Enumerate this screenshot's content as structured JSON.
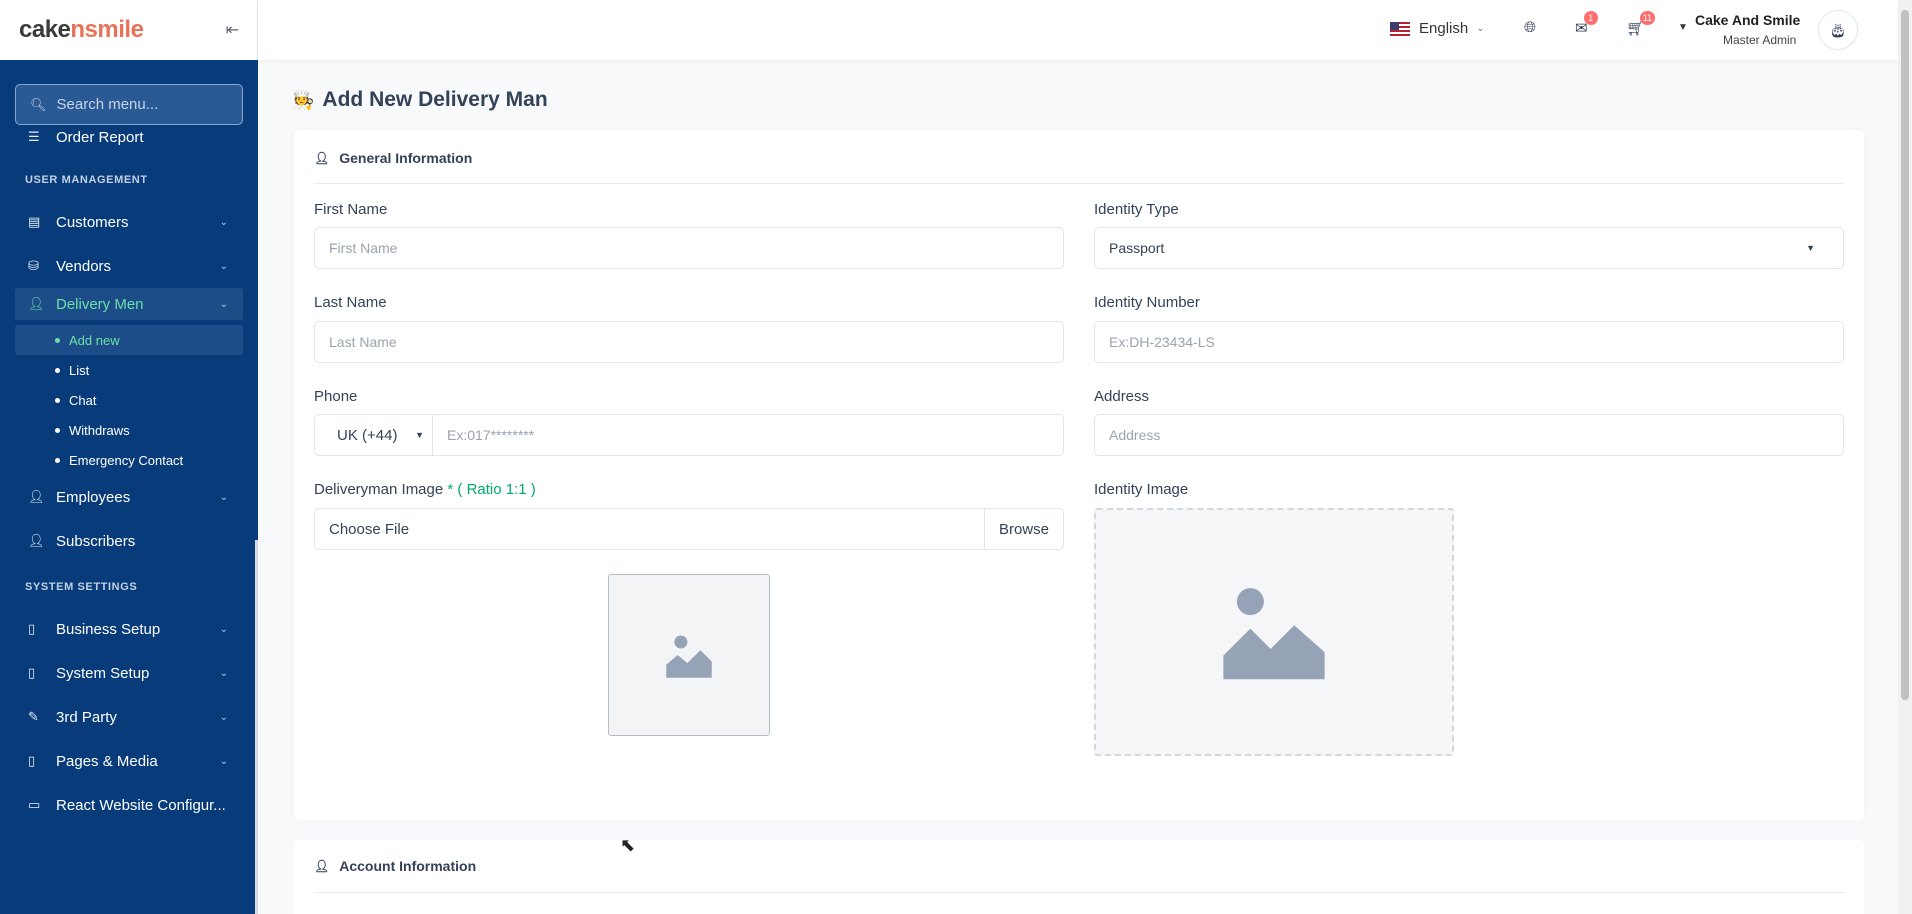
{
  "brand": {
    "part1": "cake",
    "part2": "nsmile"
  },
  "sidebar": {
    "search_placeholder": "Search menu...",
    "partial_item": "Order Report",
    "section_user": "USER MANAGEMENT",
    "customers": "Customers",
    "vendors": "Vendors",
    "delivery_men": "Delivery Men",
    "sub": [
      "Add new",
      "List",
      "Chat",
      "Withdraws",
      "Emergency Contact"
    ],
    "employees": "Employees",
    "subscribers": "Subscribers",
    "section_system": "SYSTEM SETTINGS",
    "business_setup": "Business Setup",
    "system_setup": "System Setup",
    "third_party": "3rd Party",
    "pages_media": "Pages & Media",
    "react_config": "React Website Configur..."
  },
  "header": {
    "language": "English",
    "messages_badge": "1",
    "cart_badge": "11",
    "user_name": "Cake And Smile",
    "user_role": "Master Admin"
  },
  "page": {
    "title": "Add New Delivery Man",
    "general_info": "General Information",
    "account_info": "Account Information",
    "first_name_label": "First Name",
    "first_name_placeholder": "First Name",
    "last_name_label": "Last Name",
    "last_name_placeholder": "Last Name",
    "phone_label": "Phone",
    "country_code": "UK (+44)",
    "phone_placeholder": "Ex:017********",
    "image_label": "Deliveryman Image",
    "image_req": "*",
    "image_ratio": "( Ratio 1:1 )",
    "choose_file": "Choose File",
    "browse": "Browse",
    "identity_type_label": "Identity Type",
    "identity_type_value": "Passport",
    "identity_number_label": "Identity Number",
    "identity_number_placeholder": "Ex:DH-23434-LS",
    "address_label": "Address",
    "address_placeholder": "Address",
    "identity_image_label": "Identity Image"
  }
}
